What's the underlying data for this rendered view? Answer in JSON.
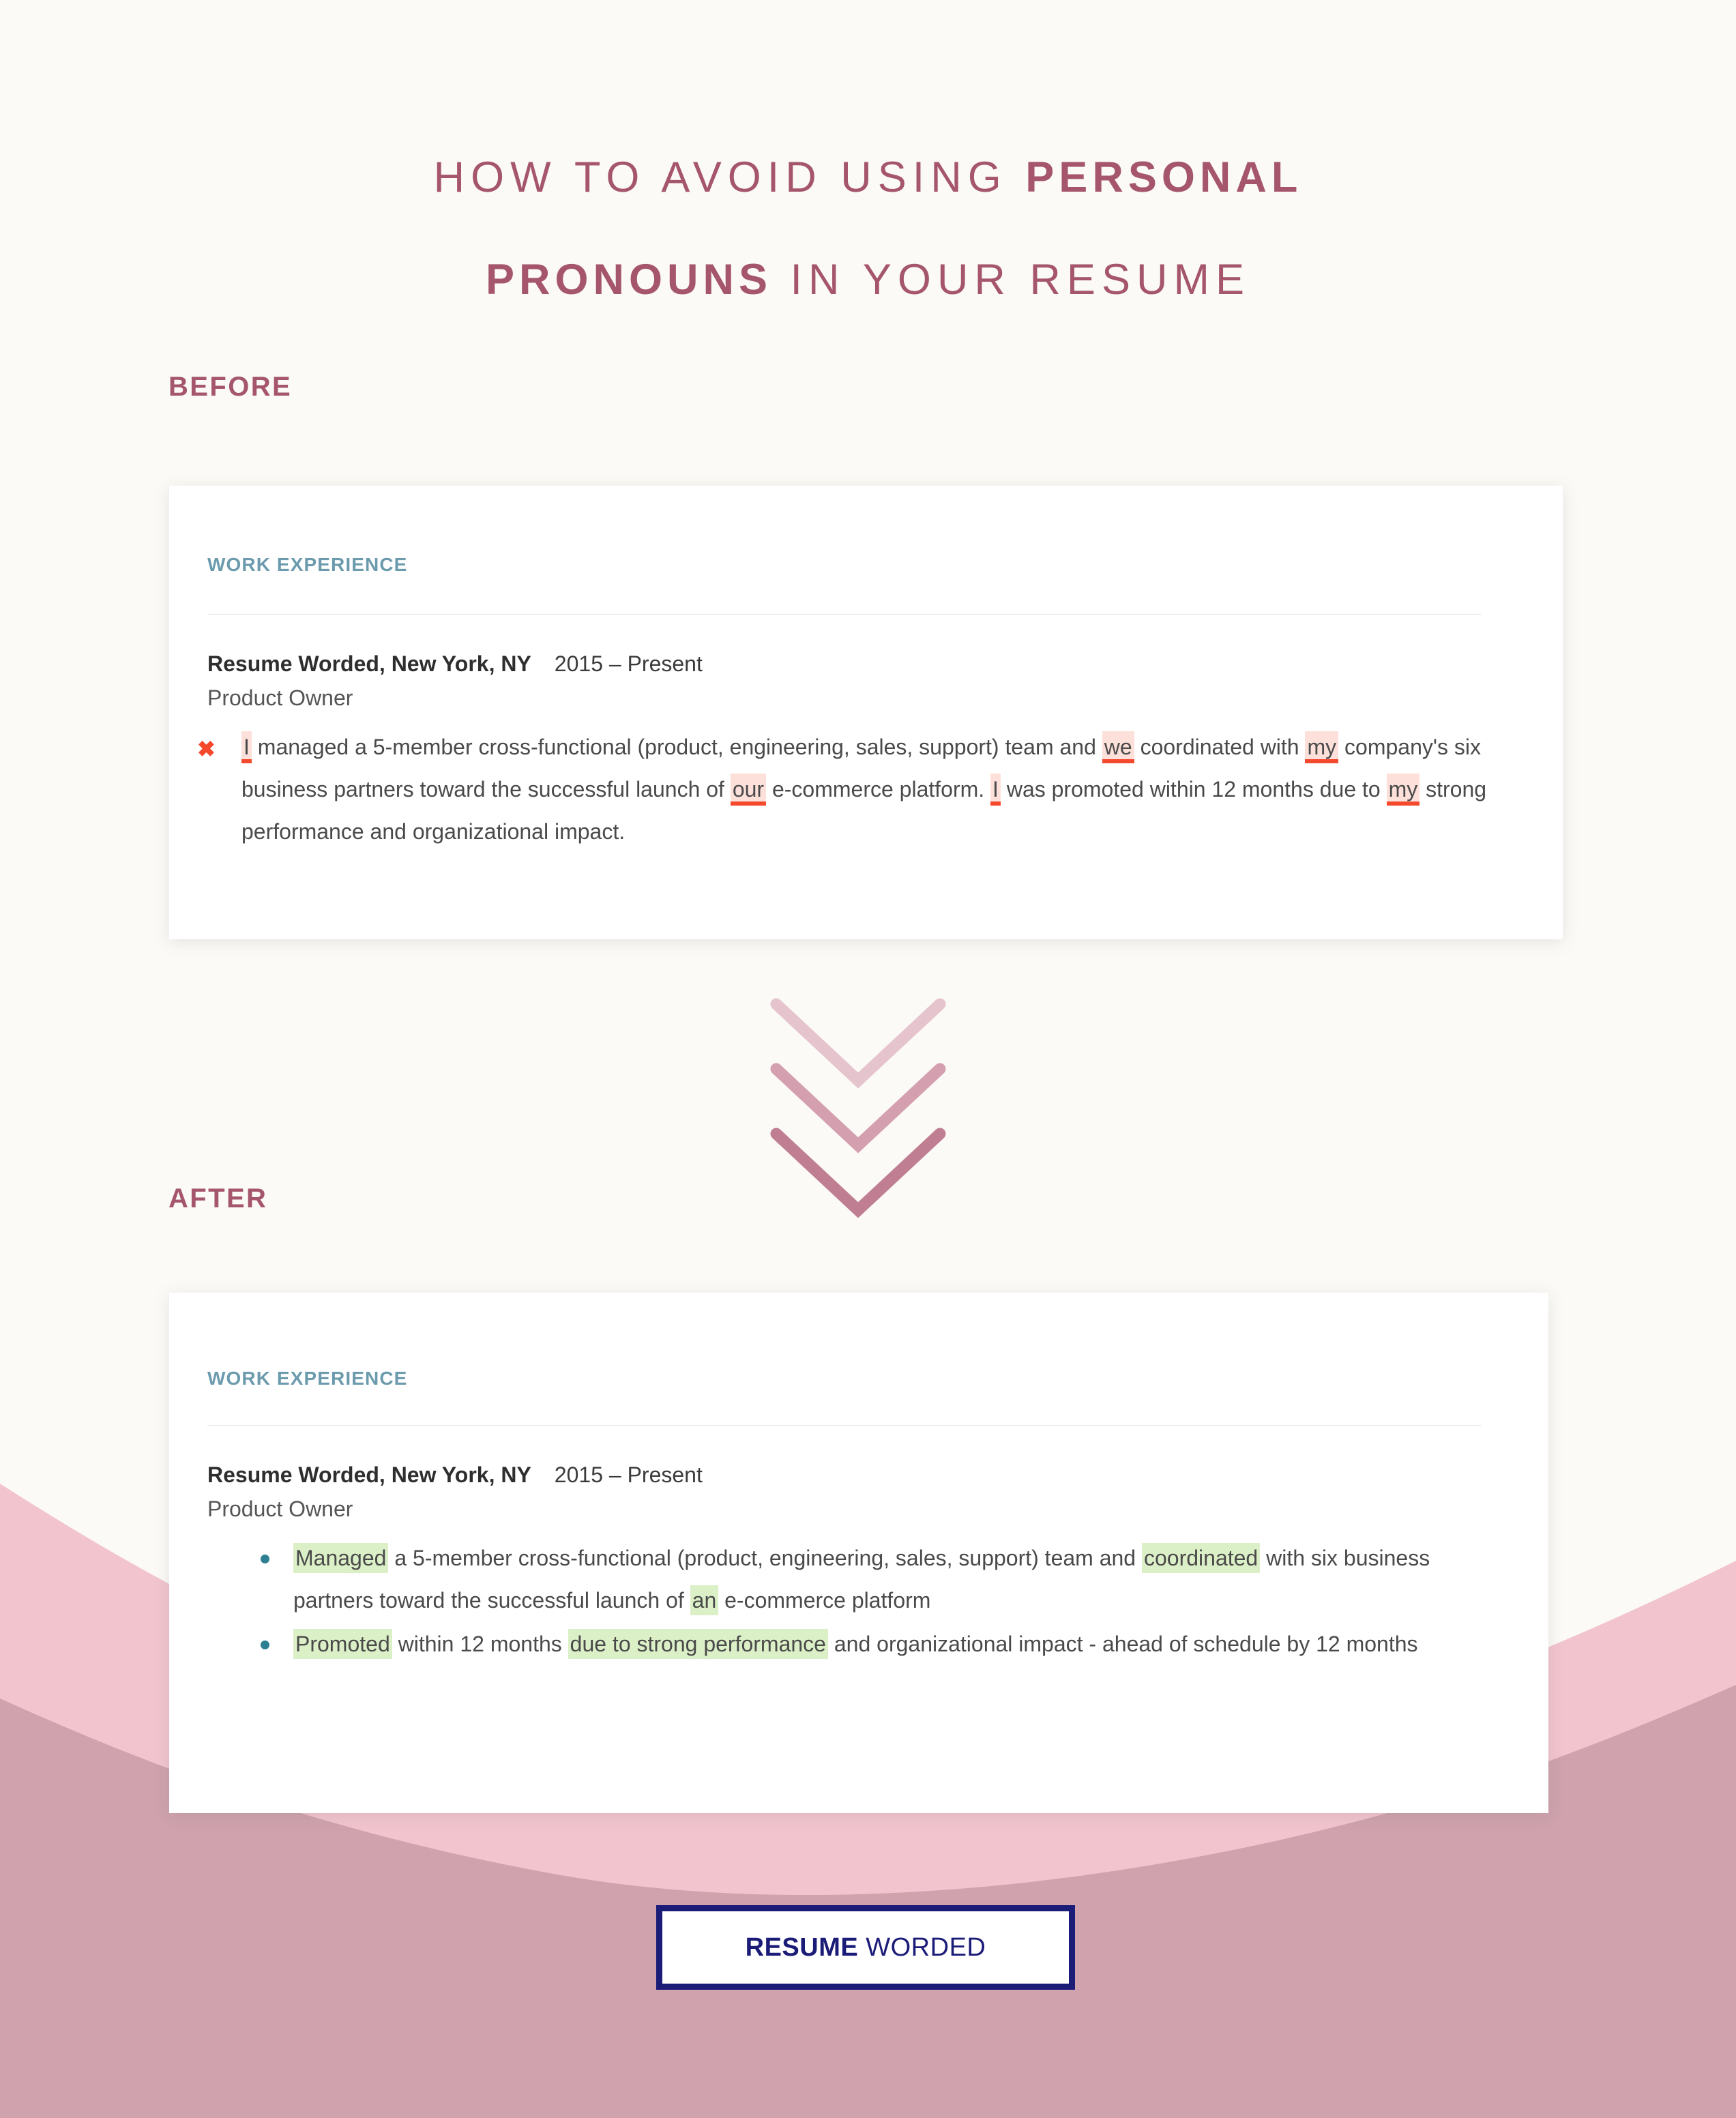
{
  "title": {
    "line1_pre": "HOW TO AVOID USING ",
    "line1_strong": "PERSONAL",
    "line2_strong": "PRONOUNS",
    "line2_post": " IN YOUR RESUME"
  },
  "labels": {
    "before": "BEFORE",
    "after": "AFTER"
  },
  "before_card": {
    "section_heading": "WORK EXPERIENCE",
    "employer": "Resume Worded, New York, NY",
    "dates": "2015 – Present",
    "role": "Product Owner",
    "mark": "✖",
    "paragraph_parts": [
      {
        "text": "I",
        "highlight": "bad"
      },
      {
        "text": " managed a 5-member cross-functional (product, engineering, sales, support) team and ",
        "highlight": "none"
      },
      {
        "text": "we",
        "highlight": "bad"
      },
      {
        "text": " coordinated with ",
        "highlight": "none"
      },
      {
        "text": "my",
        "highlight": "bad"
      },
      {
        "text": " company's six business partners toward the successful launch of ",
        "highlight": "none"
      },
      {
        "text": "our",
        "highlight": "bad"
      },
      {
        "text": " e-commerce platform. ",
        "highlight": "none"
      },
      {
        "text": "I",
        "highlight": "bad"
      },
      {
        "text": " was promoted within 12 months due to ",
        "highlight": "none"
      },
      {
        "text": "my",
        "highlight": "bad"
      },
      {
        "text": " strong performance and organizational impact.",
        "highlight": "none"
      }
    ]
  },
  "after_card": {
    "section_heading": "WORK EXPERIENCE",
    "employer": "Resume Worded, New York, NY",
    "dates": "2015 – Present",
    "role": "Product Owner",
    "bullets": [
      [
        {
          "text": "Managed",
          "highlight": "good"
        },
        {
          "text": " a 5-member cross-functional (product, engineering, sales, support) team and ",
          "highlight": "none"
        },
        {
          "text": "coordinated",
          "highlight": "good"
        },
        {
          "text": " with six business partners toward the successful launch of ",
          "highlight": "none"
        },
        {
          "text": "an",
          "highlight": "good"
        },
        {
          "text": " e-commerce platform",
          "highlight": "none"
        }
      ],
      [
        {
          "text": "Promoted",
          "highlight": "good"
        },
        {
          "text": " within 12 months ",
          "highlight": "none"
        },
        {
          "text": "due to strong performance",
          "highlight": "good"
        },
        {
          "text": " and organizational impact - ahead of schedule by 12 months",
          "highlight": "none"
        }
      ]
    ]
  },
  "logo": {
    "bold": "RESUME",
    "normal": " WORDED"
  },
  "icons": {
    "chevron": "chevron-down-icon",
    "cross": "cross-mark-icon",
    "bullet": "bullet-dot-icon"
  },
  "colors": {
    "accent_rose": "#a5566c",
    "heading_teal": "#6c9bad",
    "bad_highlight": "#fde0da",
    "bad_underline": "#f4492d",
    "good_highlight": "#dcf0c8",
    "logo_navy": "#1b1b78",
    "bg_cream": "#fbfaf6",
    "wave_light_pink": "#f2c4ce",
    "wave_dark_pink": "#cfa2ad"
  }
}
